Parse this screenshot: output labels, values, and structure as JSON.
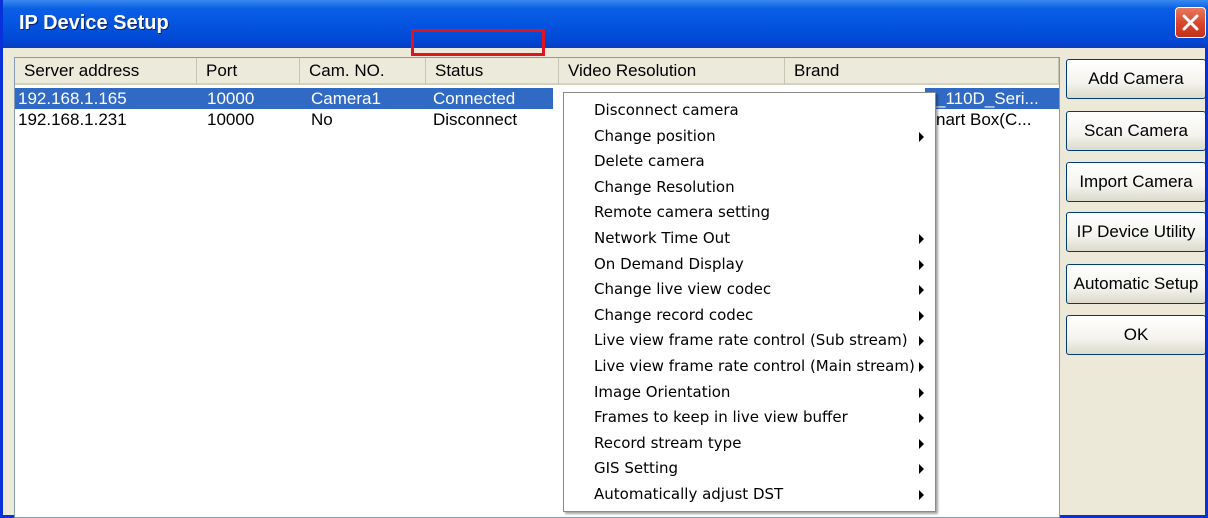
{
  "window": {
    "title": "IP Device Setup"
  },
  "table": {
    "columns": [
      "Server address",
      "Port",
      "Cam. NO.",
      "Status",
      "Video Resolution",
      "Brand"
    ],
    "rows": [
      {
        "address": "192.168.1.165",
        "port": "10000",
        "cam": "Camera1",
        "status": "Connected",
        "brand_partial": "_110D_Seri...",
        "selected": true
      },
      {
        "address": "192.168.1.231",
        "port": "10000",
        "cam": "No",
        "status": "Disconnect",
        "brand_partial": "nart Box(C...",
        "selected": false
      }
    ]
  },
  "buttons": {
    "add": "Add Camera",
    "scan": "Scan Camera",
    "import": "Import Camera",
    "utility": "IP Device Utility",
    "auto": "Automatic Setup",
    "ok": "OK"
  },
  "context_menu": {
    "items": [
      {
        "label": "Disconnect camera",
        "submenu": false
      },
      {
        "label": "Change position",
        "submenu": true
      },
      {
        "label": "Delete camera",
        "submenu": false
      },
      {
        "label": "Change Resolution",
        "submenu": false
      },
      {
        "label": "Remote camera setting",
        "submenu": false
      },
      {
        "label": "Network Time Out",
        "submenu": true
      },
      {
        "label": "On Demand Display",
        "submenu": true
      },
      {
        "label": "Change live view codec",
        "submenu": true
      },
      {
        "label": "Change record codec",
        "submenu": true
      },
      {
        "label": "Live view frame rate control (Sub stream)",
        "submenu": true
      },
      {
        "label": "Live view frame rate control (Main stream)",
        "submenu": true
      },
      {
        "label": "Image Orientation",
        "submenu": true
      },
      {
        "label": "Frames to keep in live view buffer",
        "submenu": true
      },
      {
        "label": "Record stream type",
        "submenu": true
      },
      {
        "label": "GIS Setting",
        "submenu": true
      },
      {
        "label": "Automatically adjust DST",
        "submenu": true
      }
    ]
  },
  "colors": {
    "titlebar": "#0454e0",
    "selection": "#316ac5",
    "highlight_box": "#e0141e"
  },
  "icons": {
    "close": "close-icon",
    "submenu": "submenu-arrow-icon"
  }
}
